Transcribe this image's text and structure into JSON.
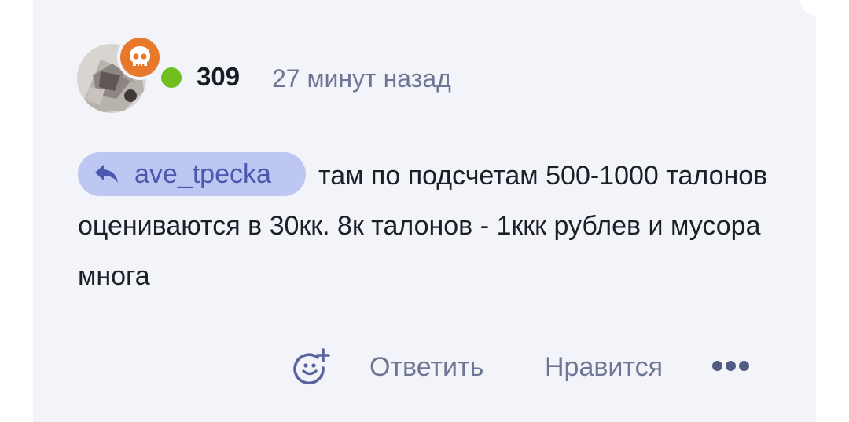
{
  "comment": {
    "author": "309",
    "time": "27 минут назад",
    "reply_to": "ave_tpecka",
    "text": "там по подсчетам 500-1000 талонов оцениваются в 30кк. 8к талонов - 1ккк рублев и мусора многа",
    "author_status": "online",
    "badge_icon": "skull-icon"
  },
  "actions": {
    "reaction_icon": "add-emoji-icon",
    "reply_label": "Ответить",
    "like_label": "Нравится",
    "more_icon": "more-dots-icon"
  },
  "colors": {
    "card_bg": "#f3f4fa",
    "chip_bg": "#bec6f2",
    "chip_text": "#4a58b0",
    "badge": "#e8792c",
    "online": "#6fbf20",
    "muted": "#6d7694"
  }
}
